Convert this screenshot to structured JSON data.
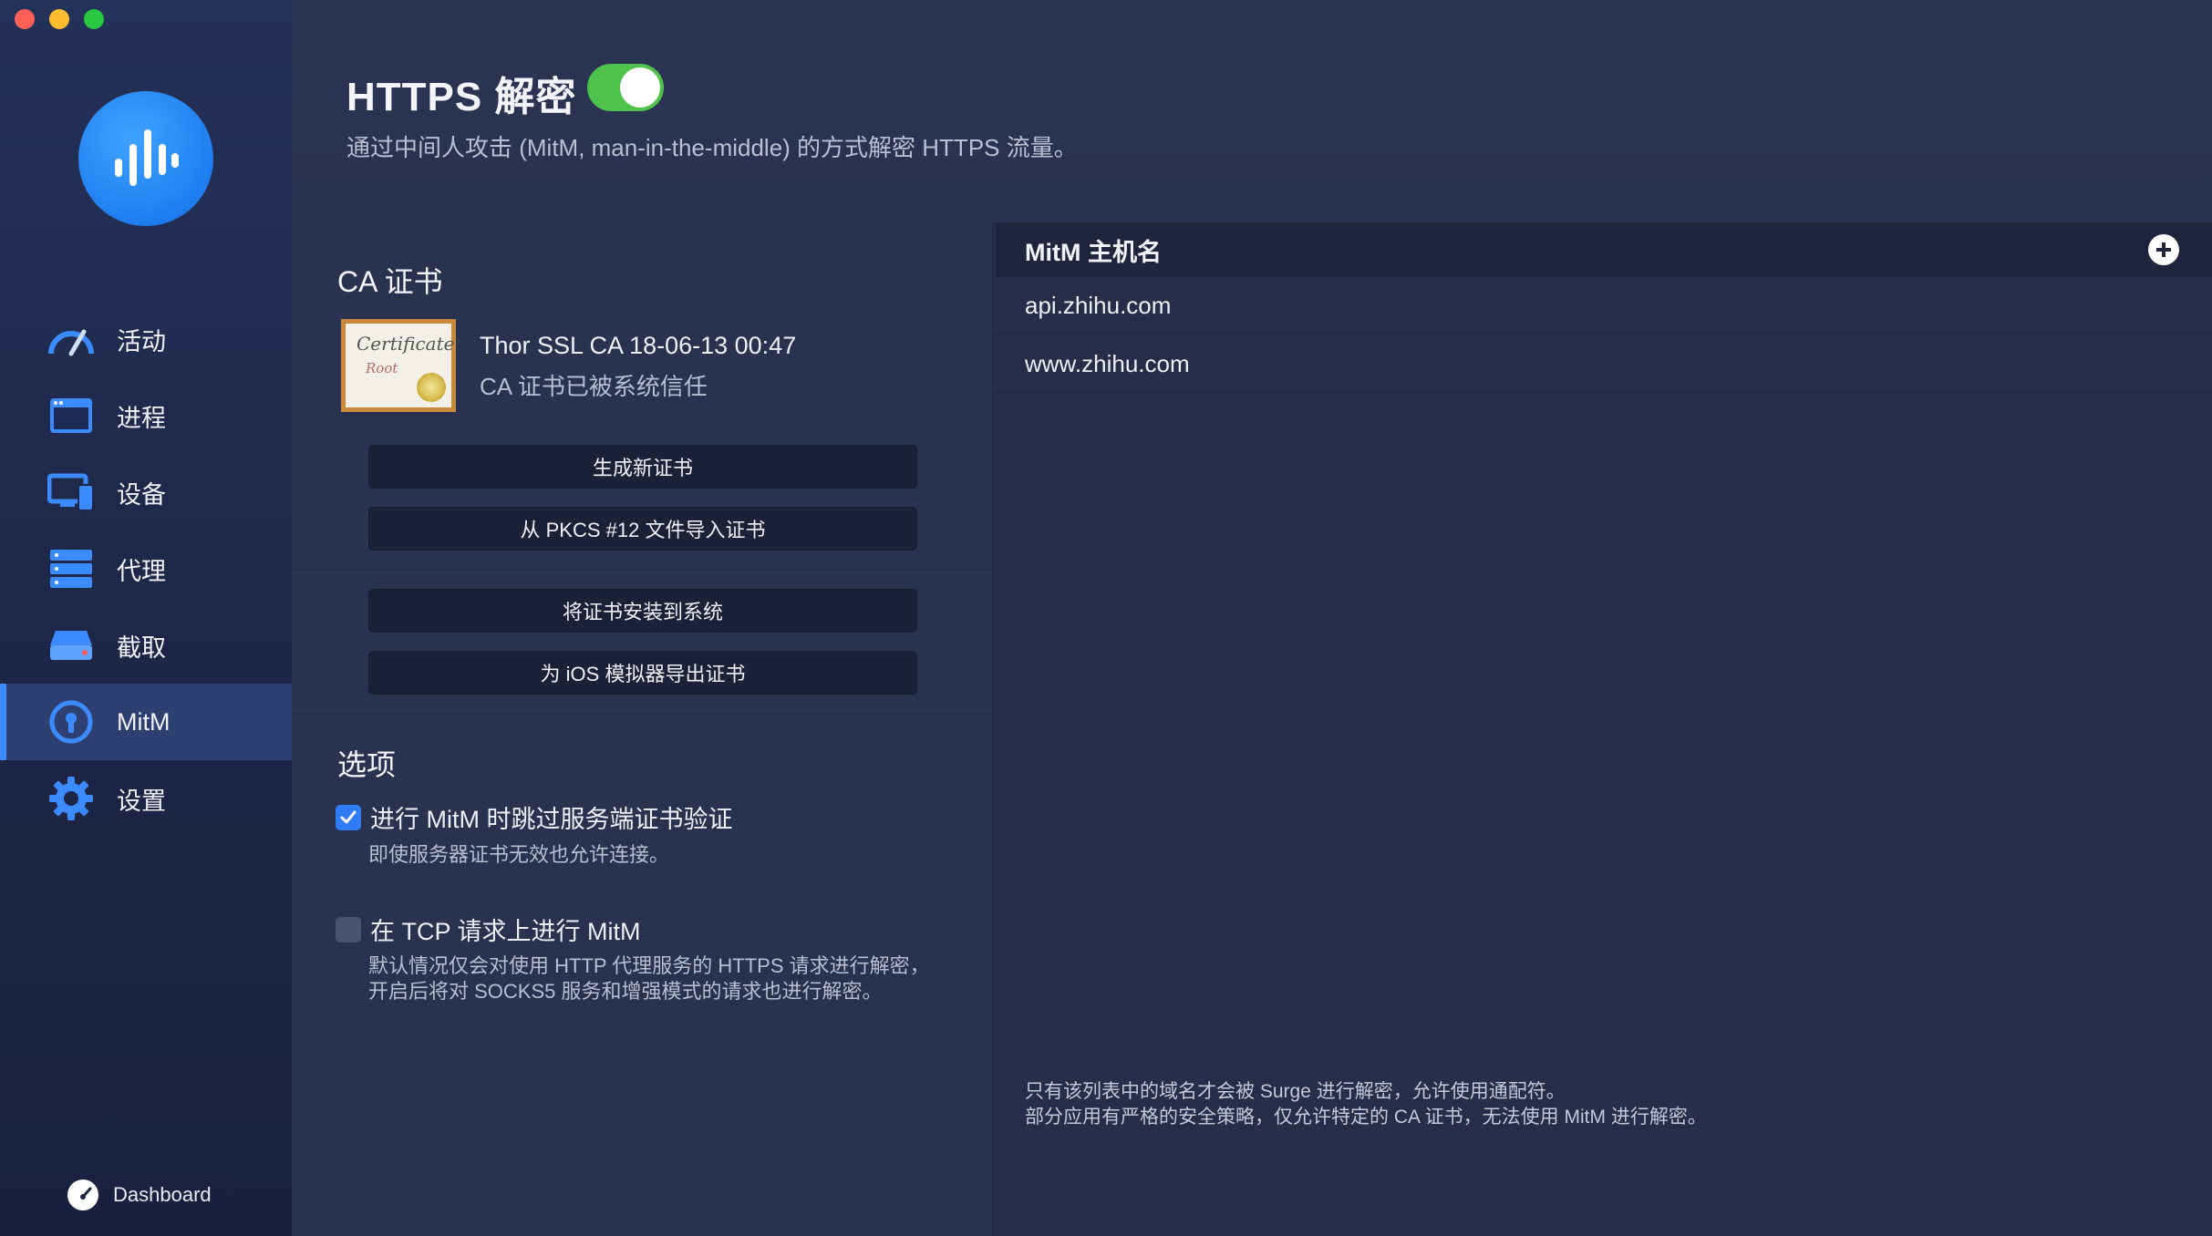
{
  "window": {
    "traffic_lights": [
      "close",
      "minimize",
      "zoom"
    ]
  },
  "sidebar": {
    "items": [
      {
        "label": "活动",
        "icon": "gauge-icon",
        "active": false
      },
      {
        "label": "进程",
        "icon": "window-icon",
        "active": false
      },
      {
        "label": "设备",
        "icon": "devices-icon",
        "active": false
      },
      {
        "label": "代理",
        "icon": "server-icon",
        "active": false
      },
      {
        "label": "截取",
        "icon": "disk-icon",
        "active": false
      },
      {
        "label": "MitM",
        "icon": "lock-icon",
        "active": true
      },
      {
        "label": "设置",
        "icon": "gear-icon",
        "active": false
      }
    ],
    "dashboard_label": "Dashboard"
  },
  "header": {
    "title": "HTTPS 解密",
    "enabled": true,
    "subtitle": "通过中间人攻击 (MitM, man-in-the-middle) 的方式解密 HTTPS 流量。"
  },
  "ca": {
    "title": "CA 证书",
    "cert_image_text": [
      "Certificate",
      "Root"
    ],
    "cert_name": "Thor SSL CA 18-06-13 00:47",
    "cert_status": "CA 证书已被系统信任",
    "buttons": {
      "generate": "生成新证书",
      "import_pkcs12": "从 PKCS #12 文件导入证书",
      "install": "将证书安装到系统",
      "export_ios": "为 iOS 模拟器导出证书"
    }
  },
  "options": {
    "title": "选项",
    "skip_verify": {
      "label": "进行 MitM 时跳过服务端证书验证",
      "checked": true,
      "desc": "即使服务器证书无效也允许连接。"
    },
    "tcp_mitm": {
      "label": "在 TCP 请求上进行 MitM",
      "checked": false,
      "desc1": "默认情况仅会对使用 HTTP 代理服务的 HTTPS 请求进行解密，",
      "desc2": "开启后将对 SOCKS5 服务和增强模式的请求也进行解密。"
    }
  },
  "hostnames": {
    "header": "MitM 主机名",
    "items": [
      "api.zhihu.com",
      "www.zhihu.com"
    ],
    "footnote1": "只有该列表中的域名才会被 Surge 进行解密，允许使用通配符。",
    "footnote2": "部分应用有严格的安全策略，仅允许特定的 CA 证书，无法使用 MitM 进行解密。"
  },
  "colors": {
    "accent": "#3b8bff",
    "toggle_on": "#4fc24b",
    "sidebar_active": "#2e3f72"
  }
}
